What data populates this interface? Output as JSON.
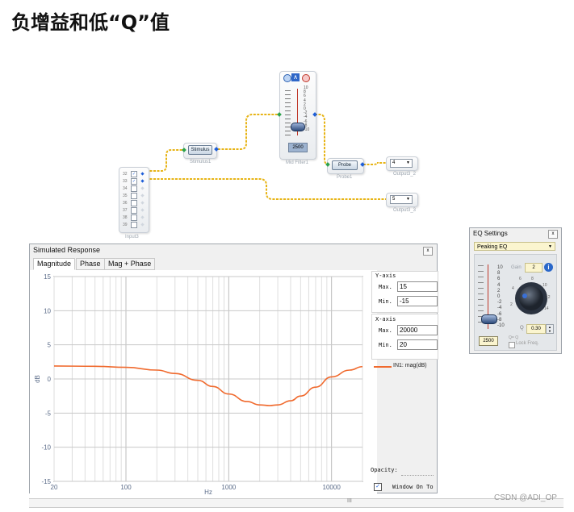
{
  "heading": "负增益和低“Q”值",
  "colors": {
    "wire": "#e7b416",
    "curve": "#f06a2e",
    "port_blue": "#1f5fd8",
    "port_green": "#2ca24b"
  },
  "schematic": {
    "input_block": {
      "label": "Input3",
      "channels": [
        "32",
        "33",
        "34",
        "35",
        "36",
        "37",
        "38",
        "39"
      ]
    },
    "stimulus": {
      "button": "Stimulus",
      "label": "Stimulus1"
    },
    "mid_filter": {
      "label": "Mid Filter1",
      "value": "2500",
      "scale": [
        "10",
        "8",
        "6",
        "4",
        "2",
        "0",
        "-2",
        "-4",
        "-6",
        "-8",
        "-10"
      ]
    },
    "probe": {
      "button": "Probe",
      "label": "Probe1"
    },
    "output_top": {
      "value": "4",
      "label": "Output3_2"
    },
    "output_bottom": {
      "value": "5",
      "label": "Output3_3"
    }
  },
  "eq_settings": {
    "title": "EQ Settings",
    "close": "x",
    "mode": "Peaking EQ",
    "scale": [
      "10",
      "8",
      "6",
      "4",
      "2",
      "0",
      "-2",
      "-4",
      "-6",
      "-8",
      "-10"
    ],
    "gain_label": "Gain",
    "gain_value": "2",
    "knob_ticks": [
      "6",
      "8",
      "10",
      "4",
      "12",
      "2",
      "14"
    ],
    "freq_value": "2500",
    "q_label": "Q",
    "q_value": "0.30",
    "q_note": "Q= Q",
    "lock_label": "Lock Freq."
  },
  "sim": {
    "title": "Simulated Response",
    "close": "x",
    "tabs": [
      "Magnitude",
      "Phase",
      "Mag + Phase"
    ],
    "yaxis_title": "Y-axis",
    "y_max_label": "Max.",
    "y_max": "15",
    "y_min_label": "Min.",
    "y_min": "-15",
    "xaxis_title": "X-axis",
    "x_max_label": "Max.",
    "x_max": "20000",
    "x_min_label": "Min.",
    "x_min": "20",
    "opacity_label": "Opacity:",
    "window_on_top": "Window On To",
    "scroll_label": "III"
  },
  "watermark": "CSDN @ADI_OP",
  "chart_data": {
    "type": "line",
    "xscale": "log",
    "xlabel": "Hz",
    "ylabel": "dB",
    "xlim": [
      20,
      20000
    ],
    "ylim": [
      -15,
      15
    ],
    "x_ticks": [
      "20",
      "100",
      "1000",
      "10000"
    ],
    "y_ticks": [
      "15",
      "10",
      "5",
      "0",
      "-5",
      "-10",
      "-15"
    ],
    "grid": true,
    "legend": "right",
    "series": [
      {
        "name": "IN1: mag(dB)",
        "x": [
          20,
          50,
          100,
          200,
          300,
          500,
          700,
          1000,
          1500,
          2000,
          2500,
          3000,
          4000,
          5000,
          7000,
          10000,
          15000,
          20000
        ],
        "y": [
          1.9,
          1.85,
          1.7,
          1.3,
          0.8,
          -0.2,
          -1.1,
          -2.2,
          -3.3,
          -3.8,
          -3.9,
          -3.8,
          -3.2,
          -2.5,
          -1.2,
          0.3,
          1.3,
          1.8
        ]
      }
    ]
  }
}
